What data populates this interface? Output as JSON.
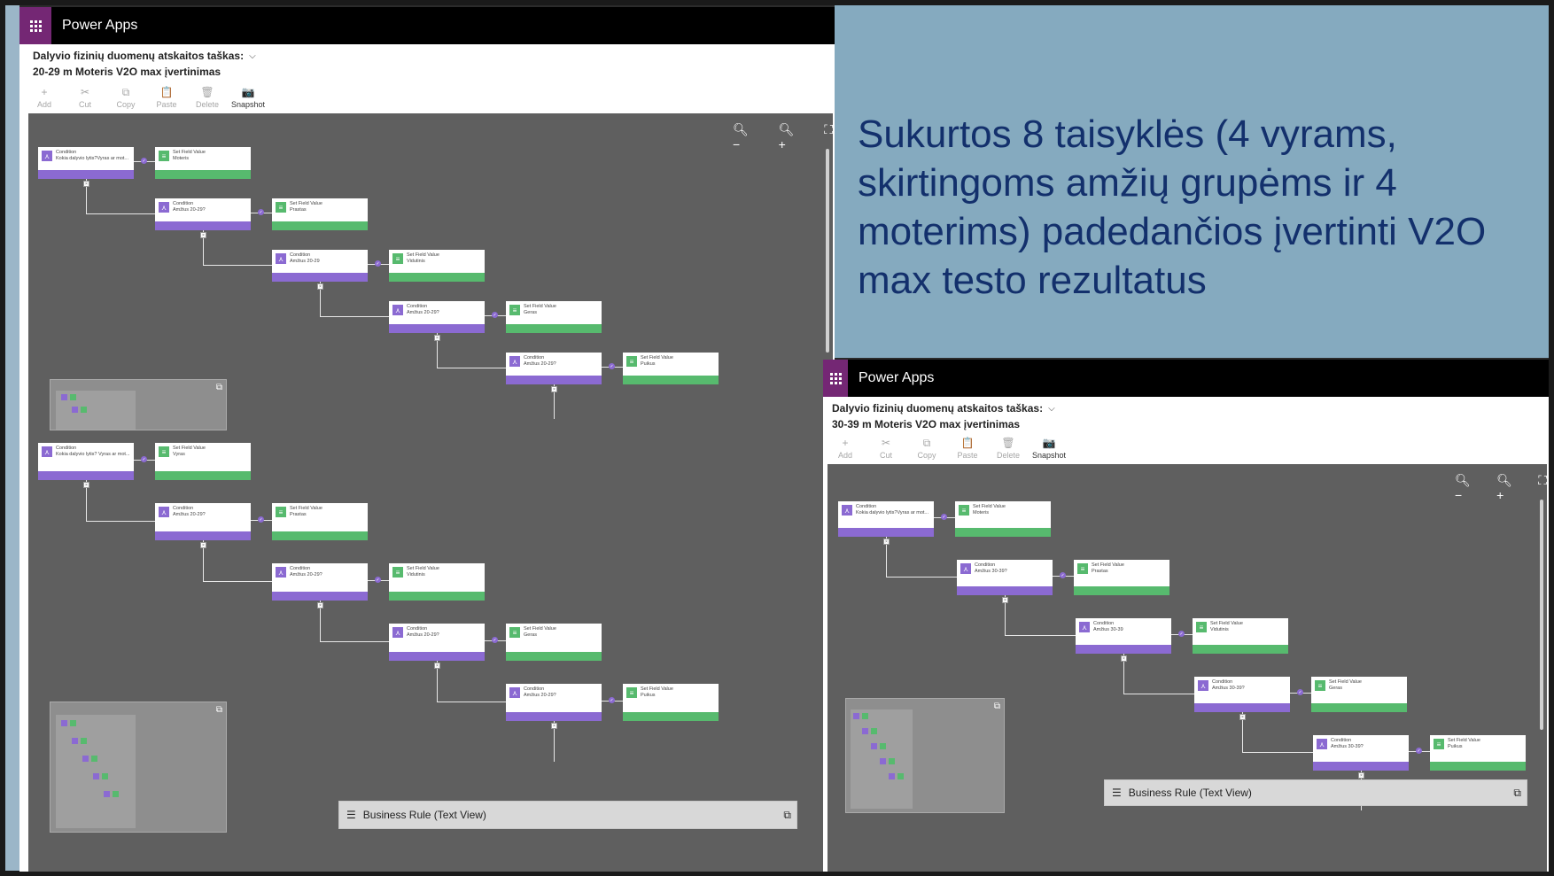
{
  "slide": {
    "heading": "Sukurtos 8 taisyklės (4 vyrams, skirtingoms amžių grupėms ir 4 moterims) padedančios įvertinti V2O max testo rezultatus"
  },
  "colors": {
    "brand_purple": "#742774",
    "condition_purple": "#8b6ad2",
    "action_green": "#57ba6e",
    "canvas_gray": "#5f5f5f",
    "slide_blue": "#85aabf",
    "slide_text": "#13306c"
  },
  "left_window": {
    "app_name": "Power Apps",
    "entity_label": "Dalyvio fizinių duomenų atskaitos taškas:",
    "rule_name": "20-29 m Moteris V2O max įvertinimas",
    "toolbar": [
      {
        "label": "Add",
        "icon": "add-icon",
        "glyph": "+"
      },
      {
        "label": "Cut",
        "icon": "cut-icon",
        "glyph": "✂"
      },
      {
        "label": "Copy",
        "icon": "copy-icon",
        "glyph": "⧉"
      },
      {
        "label": "Paste",
        "icon": "paste-icon",
        "glyph": "📋"
      },
      {
        "label": "Delete",
        "icon": "delete-icon",
        "glyph": "🗑"
      },
      {
        "label": "Snapshot",
        "icon": "camera-icon",
        "glyph": "📷"
      }
    ],
    "flow_a": [
      {
        "cond_title": "Condition",
        "cond_text": "Kokia dalyvio lytis?Vyras ar mot...",
        "set_title": "Set Field Value",
        "set_text": "Moteris"
      },
      {
        "cond_title": "Condition",
        "cond_text": "Amžius 20-29?",
        "set_title": "Set Field Value",
        "set_text": "Prastas"
      },
      {
        "cond_title": "Condition",
        "cond_text": "Amžius 20-29",
        "set_title": "Set Field Value",
        "set_text": "Vidutinis"
      },
      {
        "cond_title": "Condition",
        "cond_text": "Amžius 20-29?",
        "set_title": "Set Field Value",
        "set_text": "Geras"
      },
      {
        "cond_title": "Condition",
        "cond_text": "Amžius 20-29?",
        "set_title": "Set Field Value",
        "set_text": "Puikus"
      }
    ],
    "flow_b": [
      {
        "cond_title": "Condition",
        "cond_text": "Kokia dalyvio lytis? Vyras ar mot...",
        "set_title": "Set Field Value",
        "set_text": "Vyras"
      },
      {
        "cond_title": "Condition",
        "cond_text": "Amžius 20-29?",
        "set_title": "Set Field Value",
        "set_text": "Prastas"
      },
      {
        "cond_title": "Condition",
        "cond_text": "Amžius 20-29?",
        "set_title": "Set Field Value",
        "set_text": "Vidutinis"
      },
      {
        "cond_title": "Condition",
        "cond_text": "Amžius 20-29?",
        "set_title": "Set Field Value",
        "set_text": "Geras"
      },
      {
        "cond_title": "Condition",
        "cond_text": "Amžius 20-29?",
        "set_title": "Set Field Value",
        "set_text": "Puikus"
      }
    ],
    "business_rule_label": "Business Rule (Text View)"
  },
  "right_window": {
    "app_name": "Power Apps",
    "entity_label": "Dalyvio fizinių duomenų atskaitos taškas:",
    "rule_name": "30-39 m Moteris V2O max įvertinimas",
    "toolbar": [
      {
        "label": "Add",
        "icon": "add-icon",
        "glyph": "+"
      },
      {
        "label": "Cut",
        "icon": "cut-icon",
        "glyph": "✂"
      },
      {
        "label": "Copy",
        "icon": "copy-icon",
        "glyph": "⧉"
      },
      {
        "label": "Paste",
        "icon": "paste-icon",
        "glyph": "📋"
      },
      {
        "label": "Delete",
        "icon": "delete-icon",
        "glyph": "🗑"
      },
      {
        "label": "Snapshot",
        "icon": "camera-icon",
        "glyph": "📷"
      }
    ],
    "flow": [
      {
        "cond_title": "Condition",
        "cond_text": "Kokia dalyvio lytis?Vyras ar mot...",
        "set_title": "Set Field Value",
        "set_text": "Moteris"
      },
      {
        "cond_title": "Condition",
        "cond_text": "Amžius 30-39?",
        "set_title": "Set Field Value",
        "set_text": "Prastas"
      },
      {
        "cond_title": "Condition",
        "cond_text": "Amžius 30-39",
        "set_title": "Set Field Value",
        "set_text": "Vidutinis"
      },
      {
        "cond_title": "Condition",
        "cond_text": "Amžius 30-39?",
        "set_title": "Set Field Value",
        "set_text": "Geras"
      },
      {
        "cond_title": "Condition",
        "cond_text": "Amžius 30-39?",
        "set_title": "Set Field Value",
        "set_text": "Puikus"
      }
    ],
    "business_rule_label": "Business Rule (Text View)"
  }
}
